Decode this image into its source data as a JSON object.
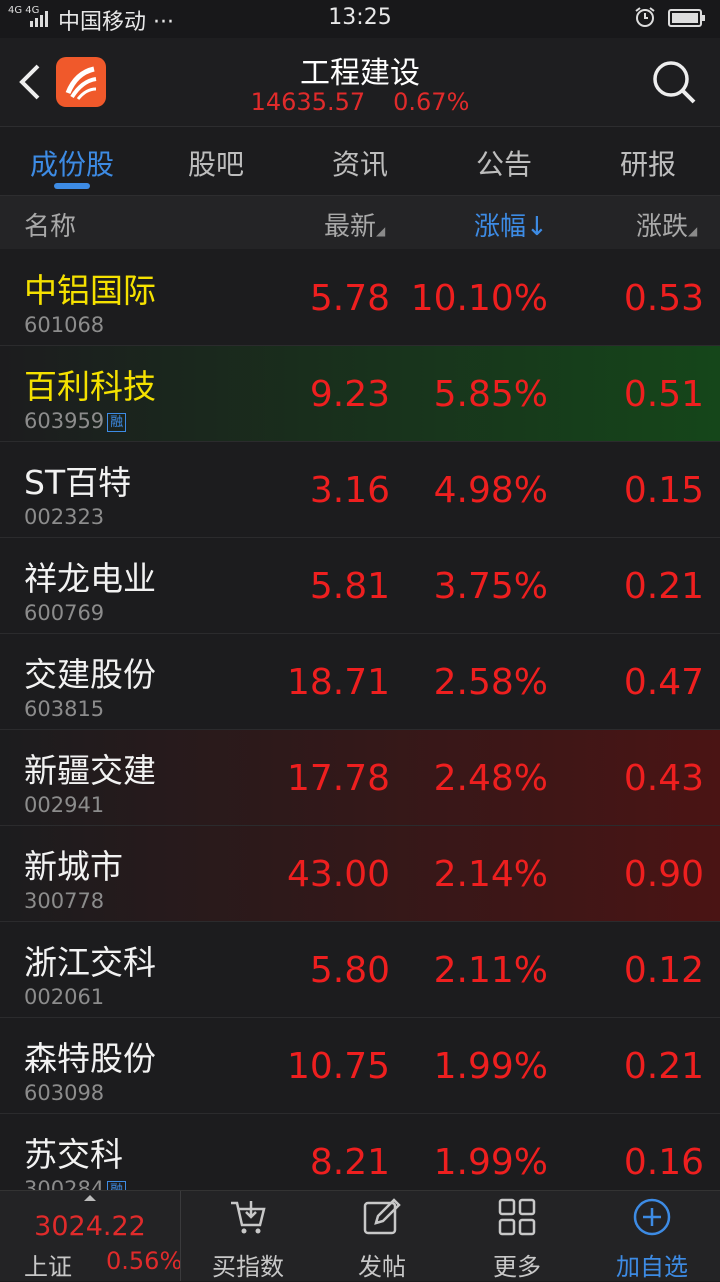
{
  "status_bar": {
    "network": "4G 4G",
    "carrier": "中国移动 ···",
    "time": "13:25"
  },
  "header": {
    "title": "工程建设",
    "index_value": "14635.57",
    "index_change_pct": "0.67%"
  },
  "tabs": [
    {
      "label": "成份股",
      "active": true
    },
    {
      "label": "股吧",
      "active": false
    },
    {
      "label": "资讯",
      "active": false
    },
    {
      "label": "公告",
      "active": false
    },
    {
      "label": "研报",
      "active": false
    }
  ],
  "columns": {
    "name": "名称",
    "latest": "最新",
    "change_pct": "涨幅↓",
    "change": "涨跌",
    "sort_indicator": "◢"
  },
  "stocks": [
    {
      "name": "中铝国际",
      "code": "601068",
      "price": "5.78",
      "change_pct": "10.10%",
      "change": "0.53",
      "name_highlight": true
    },
    {
      "name": "百利科技",
      "code": "603959",
      "badge": "融",
      "price": "9.23",
      "change_pct": "5.85%",
      "change": "0.51",
      "name_highlight": true
    },
    {
      "name": "ST百特",
      "code": "002323",
      "price": "3.16",
      "change_pct": "4.98%",
      "change": "0.15"
    },
    {
      "name": "祥龙电业",
      "code": "600769",
      "price": "5.81",
      "change_pct": "3.75%",
      "change": "0.21"
    },
    {
      "name": "交建股份",
      "code": "603815",
      "price": "18.71",
      "change_pct": "2.58%",
      "change": "0.47"
    },
    {
      "name": "新疆交建",
      "code": "002941",
      "price": "17.78",
      "change_pct": "2.48%",
      "change": "0.43"
    },
    {
      "name": "新城市",
      "code": "300778",
      "price": "43.00",
      "change_pct": "2.14%",
      "change": "0.90"
    },
    {
      "name": "浙江交科",
      "code": "002061",
      "price": "5.80",
      "change_pct": "2.11%",
      "change": "0.12"
    },
    {
      "name": "森特股份",
      "code": "603098",
      "price": "10.75",
      "change_pct": "1.99%",
      "change": "0.21"
    },
    {
      "name": "苏交科",
      "code": "300284",
      "badge": "融",
      "price": "8.21",
      "change_pct": "1.99%",
      "change": "0.16"
    }
  ],
  "bottom_bar": {
    "index_value": "3024.22",
    "index_name": "上证",
    "index_change_pct": "0.56%",
    "buy_index": "买指数",
    "post": "发帖",
    "more": "更多",
    "add_watchlist": "加自选"
  },
  "colors": {
    "up_red": "#ee1f1f",
    "accent_blue": "#3d8be4",
    "highlight_yellow": "#f5e100",
    "row_green": "#15461a",
    "row_red": "#4a1414"
  }
}
